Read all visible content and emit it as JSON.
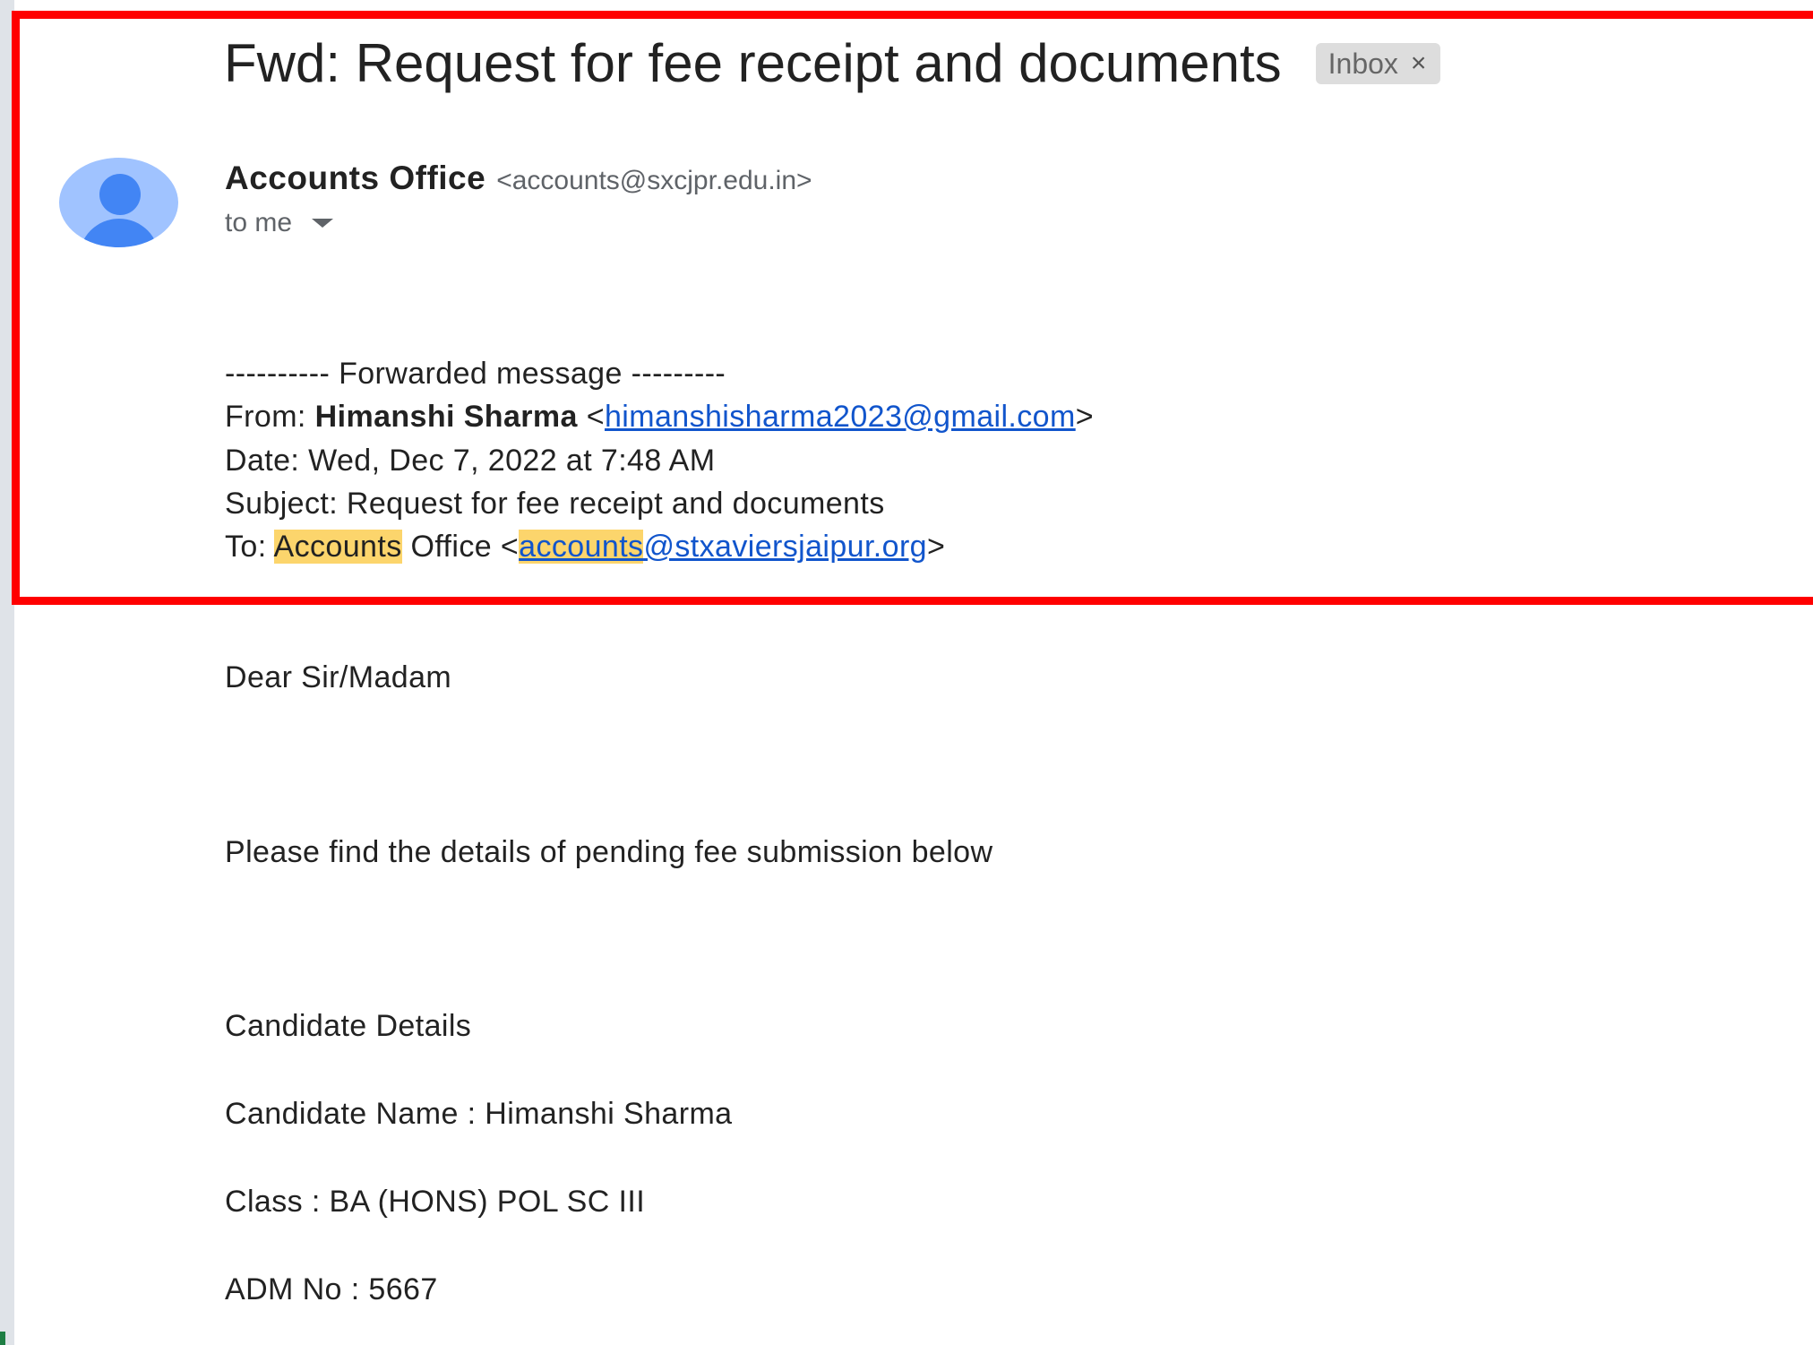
{
  "email": {
    "subject": "Fwd: Request for fee receipt and documents",
    "label": "Inbox",
    "label_close": "×",
    "sender": {
      "name": "Accounts Office",
      "email": "<accounts@sxcjpr.edu.in>"
    },
    "recipient": "to me"
  },
  "forwarded": {
    "header": "---------- Forwarded message ---------",
    "from_label": "From:",
    "from_name": "Himanshi Sharma",
    "from_email_open": "<",
    "from_email": "himanshisharma2023@gmail.com",
    "from_email_close": ">",
    "date": "Date: Wed, Dec 7, 2022 at 7:48 AM",
    "subject": "Subject: Request for fee receipt and documents",
    "to_label": "To:",
    "to_name_highlight": "Accounts",
    "to_name_rest": "Office <",
    "to_email_highlight": "accounts",
    "to_email_rest": "@stxaviersjaipur.org",
    "to_close": ">"
  },
  "body": {
    "greeting": "Dear Sir/Madam",
    "intro": "Please find the details of pending fee submission below",
    "section_title": "Candidate Details",
    "candidate_name": "Candidate Name : Himanshi Sharma",
    "class": "Class : BA (HONS) POL SC III",
    "adm_no": "ADM No : 5667"
  },
  "colors": {
    "link": "#1155cc",
    "highlight": "#fcd56c",
    "frame": "#ff0000",
    "avatar_bg": "#a0c3ff",
    "avatar_fg": "#4285f4"
  }
}
